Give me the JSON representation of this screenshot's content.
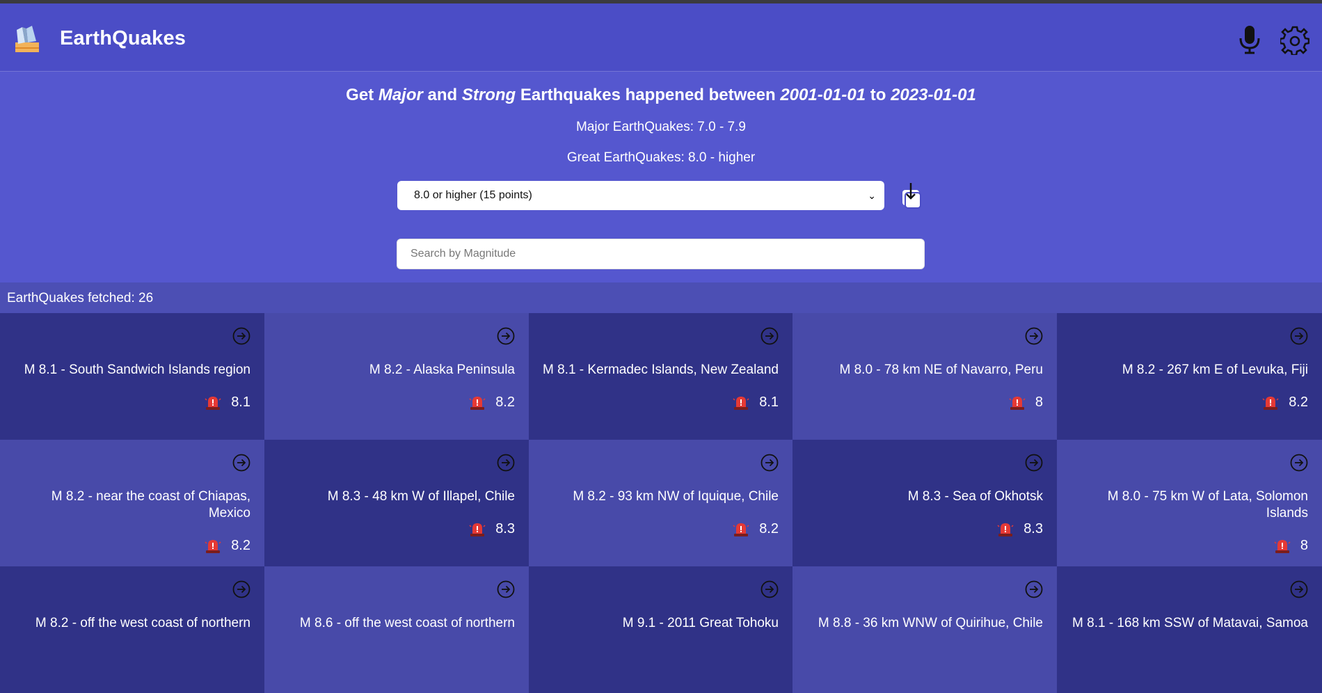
{
  "app": {
    "title": "EarthQuakes"
  },
  "hero": {
    "headline": {
      "get": "Get",
      "major": "Major",
      "and": "and",
      "strong": "Strong",
      "mid": "Earthquakes happened between",
      "start": "2001-01-01",
      "to": "to",
      "end": "2023-01-01"
    },
    "major_line": "Major EarthQuakes: 7.0 - 7.9",
    "great_line": "Great EarthQuakes: 8.0 - higher",
    "select_value": "8.0 or higher (15 points)",
    "search_placeholder": "Search by Magnitude"
  },
  "fetched_label": "EarthQuakes fetched: 26",
  "quakes": [
    {
      "place": "M 8.1 - South Sandwich Islands region",
      "mag": "8.1"
    },
    {
      "place": "M 8.2 - Alaska Peninsula",
      "mag": "8.2"
    },
    {
      "place": "M 8.1 - Kermadec Islands, New Zealand",
      "mag": "8.1"
    },
    {
      "place": "M 8.0 - 78 km NE of Navarro, Peru",
      "mag": "8"
    },
    {
      "place": "M 8.2 - 267 km E of Levuka, Fiji",
      "mag": "8.2"
    },
    {
      "place": "M 8.2 - near the coast of Chiapas, Mexico",
      "mag": "8.2"
    },
    {
      "place": "M 8.3 - 48 km W of Illapel, Chile",
      "mag": "8.3"
    },
    {
      "place": "M 8.2 - 93 km NW of Iquique, Chile",
      "mag": "8.2"
    },
    {
      "place": "M 8.3 - Sea of Okhotsk",
      "mag": "8.3"
    },
    {
      "place": "M 8.0 - 75 km W of Lata, Solomon Islands",
      "mag": "8"
    },
    {
      "place": "M 8.2 - off the west coast of northern",
      "mag": ""
    },
    {
      "place": "M 8.6 - off the west coast of northern",
      "mag": ""
    },
    {
      "place": "M 9.1 - 2011 Great Tohoku",
      "mag": ""
    },
    {
      "place": "M 8.8 - 36 km WNW of Quirihue, Chile",
      "mag": ""
    },
    {
      "place": "M 8.1 - 168 km SSW of Matavai, Samoa",
      "mag": ""
    }
  ],
  "colors": {
    "navbar": "#4b4dc6",
    "hero": "#5557cf",
    "card_dark": "#303287",
    "card_light": "#484aa9",
    "siren": "#e53935"
  },
  "icons": [
    "app-logo-icon",
    "microphone-icon",
    "gear-icon",
    "download-icon",
    "arrow-right-circle-icon",
    "siren-alert-icon",
    "chevron-down-icon"
  ]
}
